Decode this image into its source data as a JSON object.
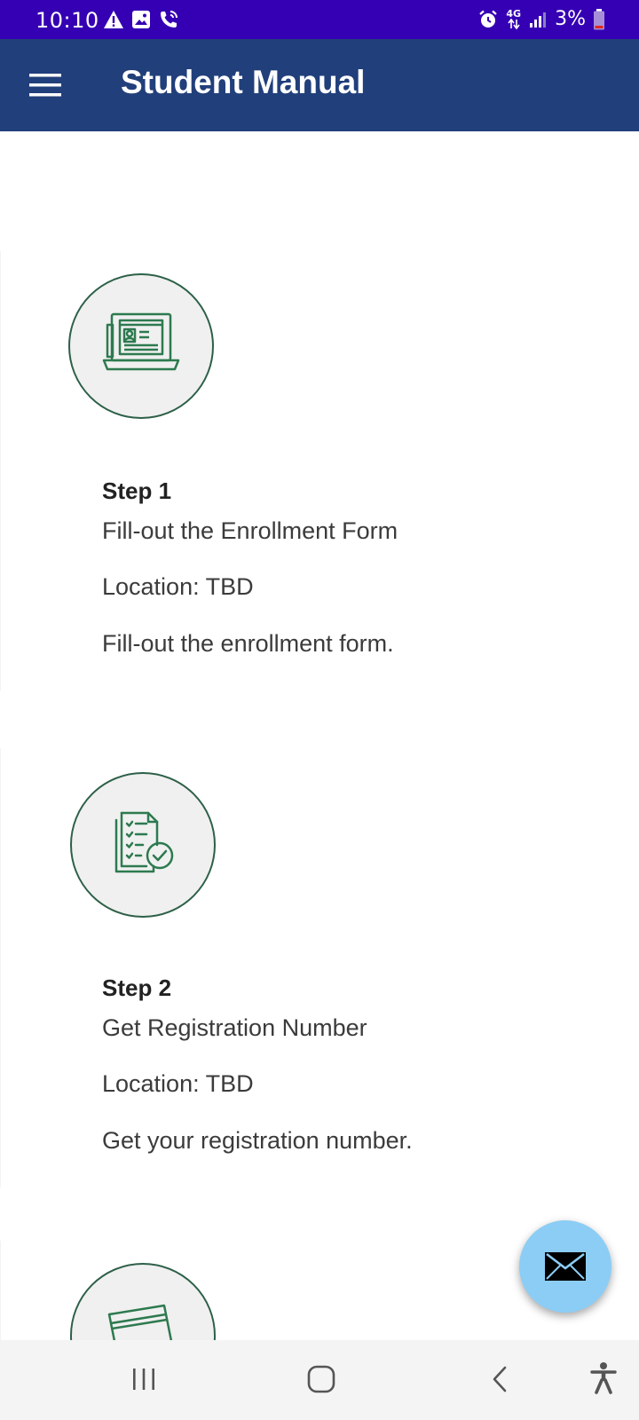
{
  "status_bar": {
    "time": "10:10",
    "network": "4G",
    "battery": "3%",
    "left_icons": [
      "warning-icon",
      "image-icon",
      "wifi-calling-icon"
    ],
    "right_icons": [
      "alarm-icon",
      "data-arrows-icon",
      "signal-icon",
      "battery-icon"
    ]
  },
  "app_bar": {
    "title": "Student Manual",
    "menu_icon": "hamburger-menu-icon",
    "background": "#213f7a"
  },
  "steps": [
    {
      "icon": "online-form-icon",
      "title": "Step 1",
      "subtitle": "Fill-out the Enrollment Form",
      "location": "Location: TBD",
      "description": "Fill-out the enrollment form."
    },
    {
      "icon": "checklist-document-icon",
      "title": "Step 2",
      "subtitle": "Get Registration Number",
      "location": "Location: TBD",
      "description": "Get your registration number."
    },
    {
      "icon": "payment-card-icon"
    }
  ],
  "fab": {
    "icon": "mail-icon",
    "color": "#8ccdf5"
  },
  "nav_bar": {
    "buttons": [
      "recent-apps-icon",
      "home-icon",
      "back-icon",
      "accessibility-icon"
    ]
  },
  "colors": {
    "status_bar": "#3500b3",
    "icon_green": "#2d7a4f",
    "circle_border": "#2d6048"
  }
}
